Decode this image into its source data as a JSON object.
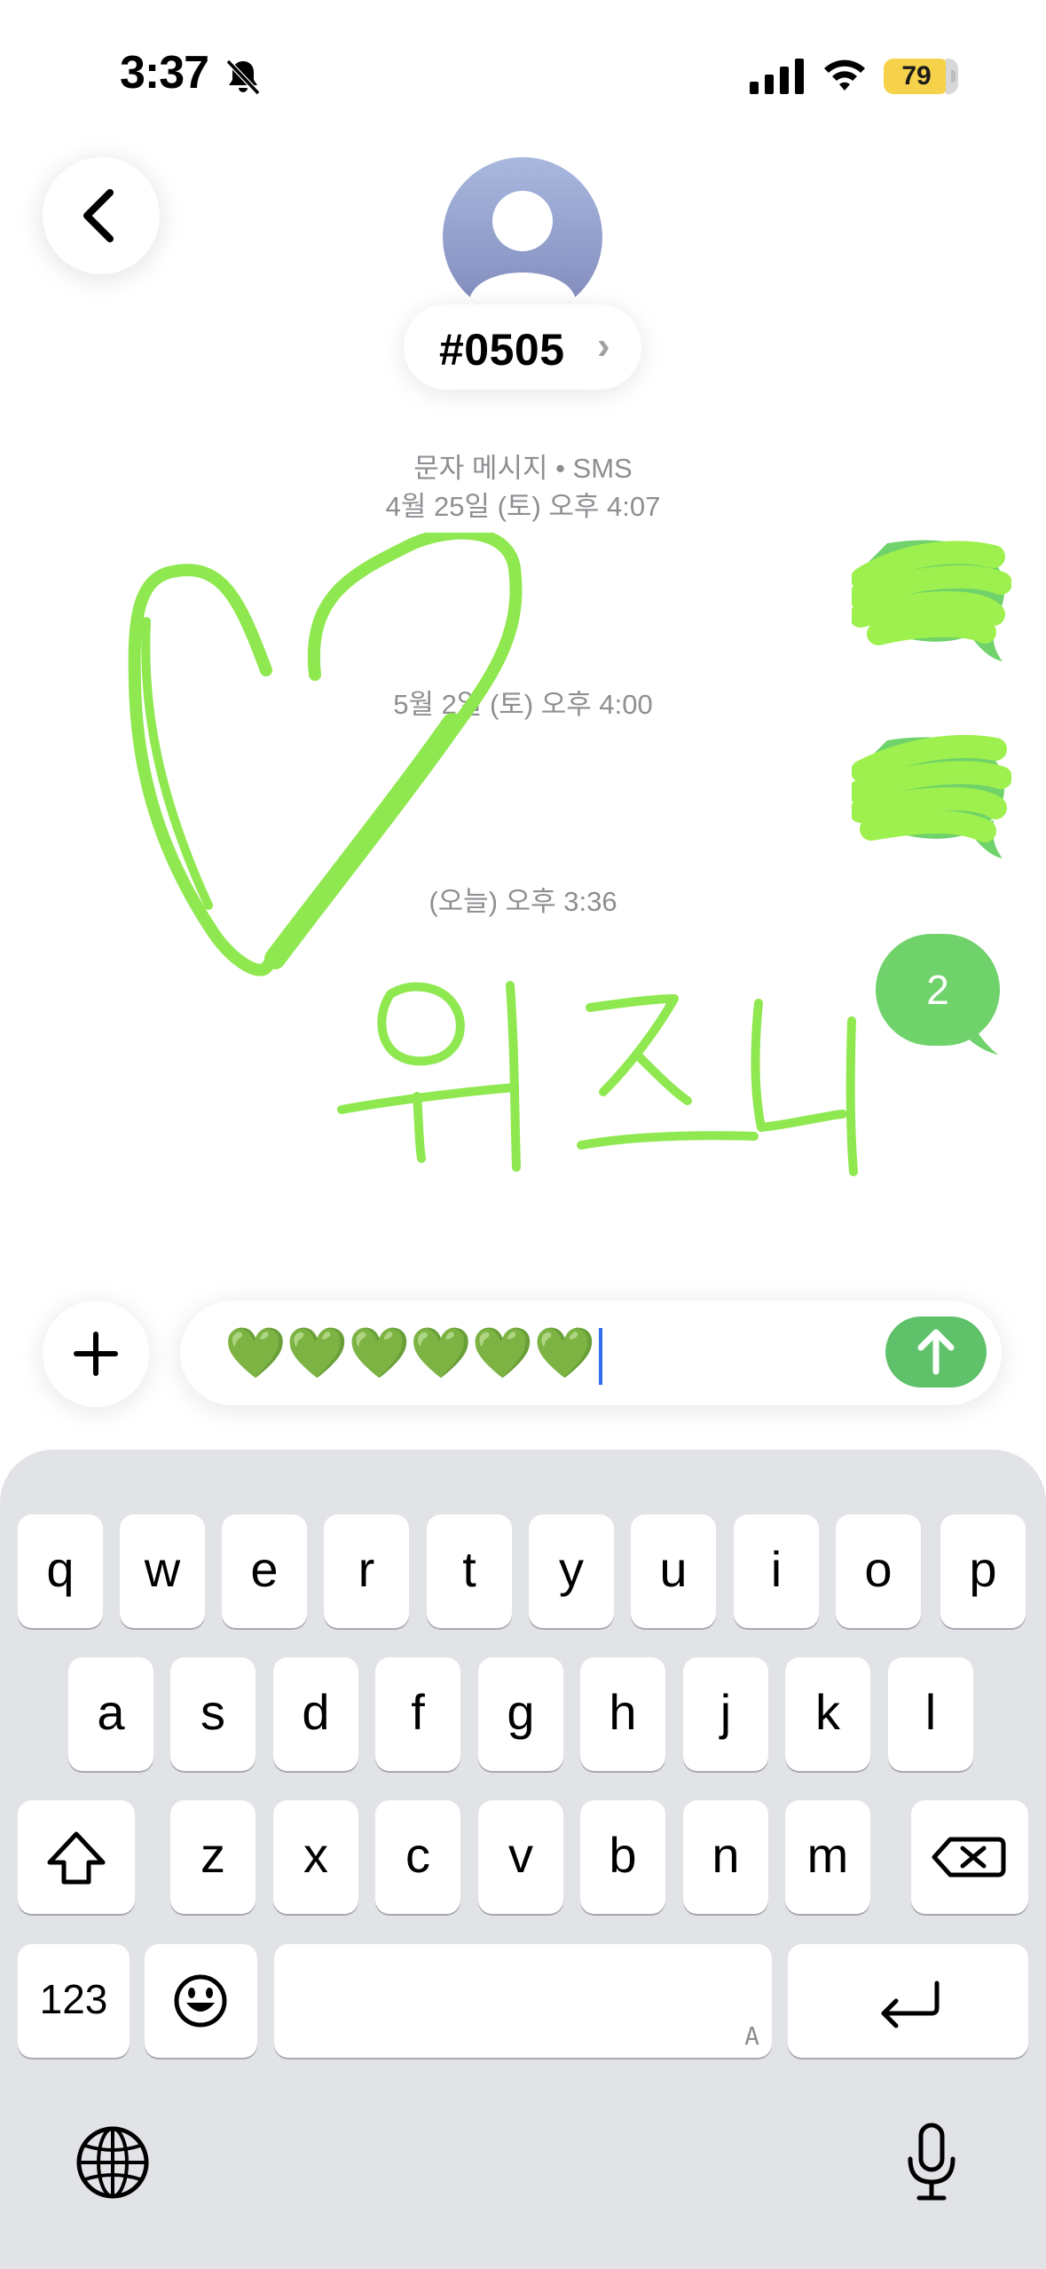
{
  "status_bar": {
    "time": "3:37",
    "battery_level": "79"
  },
  "header": {
    "contact_name": "#0505",
    "chevron": "›"
  },
  "thread": {
    "message_type": "문자 메시지 • SMS",
    "timestamps": [
      "4월 25일 (토) 오후 4:07",
      "5월 2일 (토) 오후 4:00",
      "(오늘) 오후 3:36"
    ],
    "bubble_badge_text": "2",
    "handwriting_text": "위즈니"
  },
  "composer": {
    "text": "💚💚💚💚💚💚"
  },
  "keyboard": {
    "row1": [
      "q",
      "w",
      "e",
      "r",
      "t",
      "y",
      "u",
      "i",
      "o",
      "p"
    ],
    "row2": [
      "a",
      "s",
      "d",
      "f",
      "g",
      "h",
      "j",
      "k",
      "l"
    ],
    "row3": [
      "z",
      "x",
      "c",
      "v",
      "b",
      "n",
      "m"
    ],
    "numbers_key": "123",
    "space_hint": "A"
  },
  "colors": {
    "accent_green": "#6fd26a",
    "drawing_green": "#8fe84f",
    "send_green": "#5fc26a",
    "battery_yellow": "#f5d24a"
  },
  "icons": [
    "back-chevron-icon",
    "bell-slash-icon",
    "signal-icon",
    "wifi-icon",
    "person-icon",
    "plus-icon",
    "arrow-up-icon",
    "shift-icon",
    "delete-icon",
    "emoji-icon",
    "return-icon",
    "globe-icon",
    "microphone-icon"
  ]
}
